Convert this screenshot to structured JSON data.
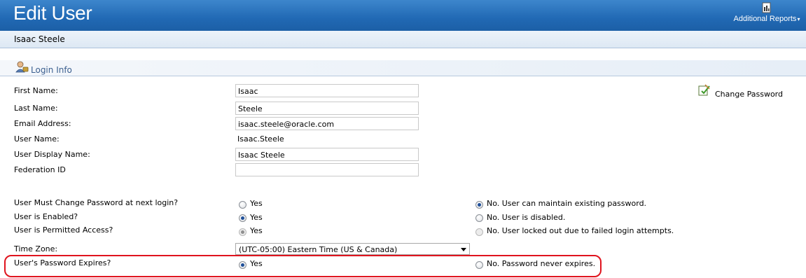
{
  "header": {
    "title": "Edit User",
    "additional_reports": "Additional Reports",
    "reports_caret": "▾"
  },
  "subbar": {
    "user_name": "Isaac Steele"
  },
  "section": {
    "title": "Login Info"
  },
  "fields": {
    "first_name": {
      "label": "First Name:",
      "value": "Isaac"
    },
    "last_name": {
      "label": "Last Name:",
      "value": "Steele"
    },
    "email": {
      "label": "Email Address:",
      "value": "isaac.steele@oracle.com"
    },
    "user_name": {
      "label": "User Name:",
      "value": "Isaac.Steele"
    },
    "display_name": {
      "label": "User Display Name:",
      "value": "Isaac Steele"
    },
    "federation_id": {
      "label": "Federation ID",
      "value": ""
    }
  },
  "change_password": "Change Password",
  "radios": {
    "must_change": {
      "label": "User Must Change Password at next login?",
      "yes": "Yes",
      "no": "No. User can maintain existing password.",
      "selected": "no"
    },
    "enabled": {
      "label": "User is Enabled?",
      "yes": "Yes",
      "no": "No. User is disabled.",
      "selected": "yes"
    },
    "permitted": {
      "label": "User is Permitted Access?",
      "yes": "Yes",
      "no": "No. User locked out due to failed login attempts.",
      "selected": "yes",
      "disabled": true
    },
    "password_expires": {
      "label": "User's Password Expires?",
      "yes": "Yes",
      "no": "No. Password never expires.",
      "selected": "yes"
    }
  },
  "timezone": {
    "label": "Time Zone:",
    "value": "(UTC-05:00) Eastern Time (US & Canada)"
  },
  "colors": {
    "header": "#2169b4",
    "highlight": "#e0141e",
    "section_title": "#3b5f8f"
  },
  "icons": {
    "reports": "report-document-icon",
    "section": "user-login-icon",
    "change_password": "edit-password-icon"
  }
}
